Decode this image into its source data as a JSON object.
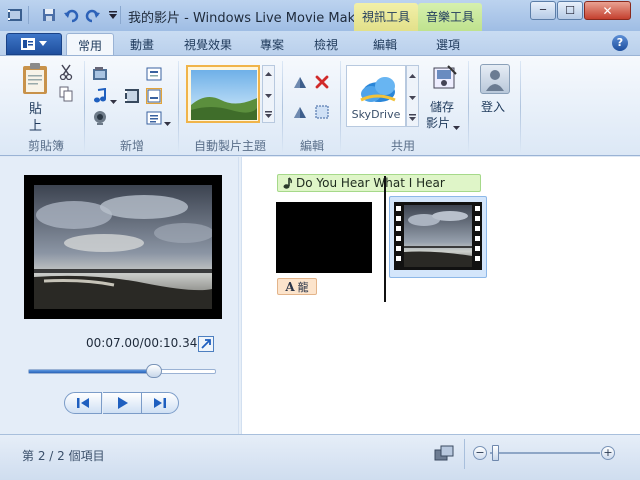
{
  "window": {
    "title": "我的影片 - Windows Live Movie Maker",
    "context_tabs": [
      {
        "label": "視訊工具",
        "color": "#e8e79a"
      },
      {
        "label": "音樂工具",
        "color": "#c6e89a"
      }
    ],
    "buttons": {
      "minimize": "─",
      "maximize": "☐",
      "close": "✕"
    }
  },
  "ribbon": {
    "file_menu_icon": "file-menu-icon",
    "tabs": [
      "常用",
      "動畫",
      "視覺效果",
      "專案",
      "檢視",
      "編輯",
      "選項"
    ],
    "active_tab": "常用",
    "help_label": "?",
    "groups": {
      "clipboard": {
        "label": "剪貼簿",
        "paste_label": "貼\n上",
        "paste_top": "貼",
        "paste_bottom": "上"
      },
      "add": {
        "label": "新增"
      },
      "themes": {
        "label": "自動製片主題"
      },
      "editing": {
        "label": "編輯"
      },
      "share": {
        "label": "共用",
        "skydrive_label": "SkyDrive",
        "save_movie_top": "儲存",
        "save_movie_bottom": "影片",
        "login_label": "登入"
      }
    }
  },
  "preview": {
    "time": "00:07.00/00:10.34",
    "progress": 0.67
  },
  "storyboard": {
    "music_caption": "Do You Hear What I Hear",
    "title_caption_icon": "A",
    "title_caption": "龍"
  },
  "status": {
    "item_count": "第 2 / 2 個項目",
    "zoom_minus": "−",
    "zoom_plus": "+"
  },
  "colors": {
    "accent": "#1f4f9e",
    "music_bg": "#dff5c8",
    "title_bg": "#fce4cc"
  }
}
